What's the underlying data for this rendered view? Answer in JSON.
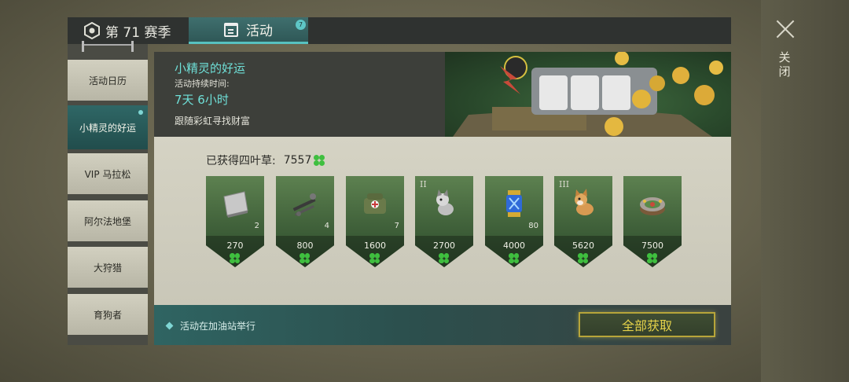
{
  "header": {
    "season_tab": "第 71 赛季",
    "activity_tab": "活动",
    "activity_badge": "7"
  },
  "close": {
    "label": "关闭"
  },
  "sidebar": {
    "items": [
      {
        "label": "活动日历",
        "active": false
      },
      {
        "label": "小精灵的好运",
        "active": true
      },
      {
        "label": "VIP 马拉松",
        "active": false
      },
      {
        "label": "阿尔法地堡",
        "active": false
      },
      {
        "label": "大狩猎",
        "active": false
      },
      {
        "label": "育狗者",
        "active": false
      }
    ]
  },
  "banner": {
    "title": "小精灵的好运",
    "duration_label": "活动持续时间:",
    "duration_value": "7天 6小时",
    "description": "跟随彩虹寻找财富"
  },
  "rewards": {
    "earned_label": "已获得四叶草:",
    "earned_value": "7557",
    "cards": [
      {
        "icon": "steel-plate-icon",
        "qty": "2",
        "cost": "270",
        "tier": ""
      },
      {
        "icon": "weapon-parts-icon",
        "qty": "4",
        "cost": "800",
        "tier": ""
      },
      {
        "icon": "medkit-bag-icon",
        "qty": "7",
        "cost": "1600",
        "tier": ""
      },
      {
        "icon": "husky-puppy-icon",
        "qty": "",
        "cost": "2700",
        "tier": "II"
      },
      {
        "icon": "energy-canister-icon",
        "qty": "80",
        "cost": "4000",
        "tier": ""
      },
      {
        "icon": "corgi-puppy-icon",
        "qty": "",
        "cost": "5620",
        "tier": "III"
      },
      {
        "icon": "roulette-cake-icon",
        "qty": "",
        "cost": "7500",
        "tier": ""
      }
    ]
  },
  "footer": {
    "note": "活动在加油站举行",
    "claim_all": "全部获取"
  },
  "colors": {
    "accent": "#57c1c0",
    "title_cyan": "#6fe0d8",
    "clover_green": "#3fbf3f",
    "gold": "#e4d24a"
  }
}
